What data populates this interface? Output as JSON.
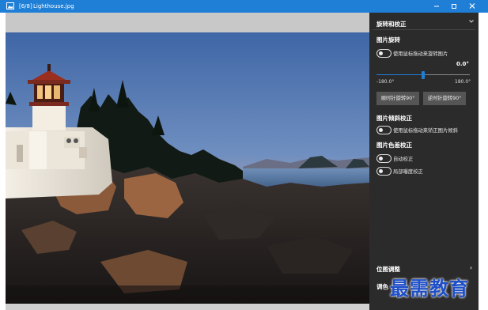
{
  "titlebar": {
    "counter": "[6/8]",
    "filename": "Lighthouse.jpg",
    "icons": [
      "picture-icon",
      "minimize-icon",
      "maximize-icon",
      "close-icon"
    ]
  },
  "viewer": {
    "image_description_icon": "photo-lighthouse"
  },
  "panel": {
    "header": "旋转和校正",
    "rotate": {
      "title": "图片旋转",
      "toggle_label": "使用鼠标拖动来旋转图片",
      "angle_value": "0.0°",
      "range_min": "-180.0°",
      "range_max": "180.0°",
      "slider_value": 0,
      "slider_min": -180,
      "slider_max": 180,
      "cw_button": "顺时针旋转90°",
      "ccw_button": "逆时针旋转90°"
    },
    "tilt": {
      "title": "图片倾斜校正",
      "toggle_label": "使用鼠标拖动来矫正图片倾斜"
    },
    "color": {
      "title": "图片色差校正",
      "auto_label": "自动校正",
      "local_label": "局部曝度校正"
    },
    "position": {
      "label": "位图调整"
    },
    "tone": {
      "label": "调色"
    }
  },
  "watermark": "最需教育",
  "colors": {
    "titlebar": "#1f7fd6",
    "panel": "#2b2b2b",
    "accent": "#1f7fd6",
    "watermark": "#1e4fc8"
  }
}
